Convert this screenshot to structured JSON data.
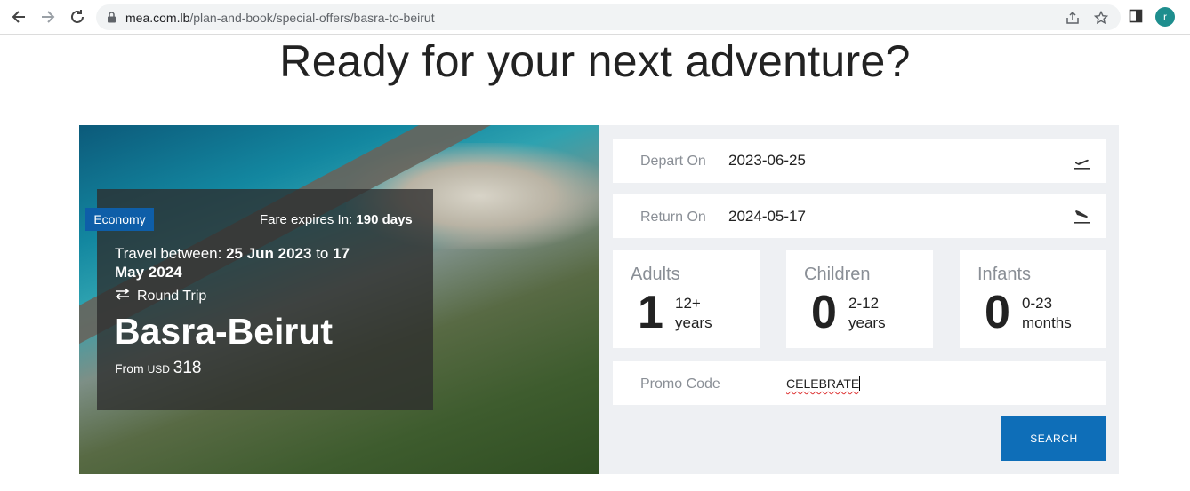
{
  "browser": {
    "url_domain": "mea.com.lb",
    "url_path": "/plan-and-book/special-offers/basra-to-beirut",
    "profile_initial": "r",
    "icons": [
      "back-icon",
      "forward-icon",
      "reload-icon",
      "lock-icon",
      "share-icon",
      "star-icon",
      "side-panel-icon"
    ]
  },
  "page": {
    "headline": "Ready for your next adventure?"
  },
  "offer": {
    "cabin": "Economy",
    "fare_expires_label": "Fare expires In:",
    "fare_expires_value": "190 days",
    "travel_label": "Travel between:",
    "travel_from": "25 Jun 2023",
    "travel_to_word": "to",
    "travel_to": "17 May 2024",
    "trip_type": "Round Trip",
    "route": "Basra-Beirut",
    "price_prefix": "From",
    "currency": "USD",
    "price": "318"
  },
  "form": {
    "depart_label": "Depart On",
    "depart_value": "2023-06-25",
    "return_label": "Return On",
    "return_value": "2024-05-17",
    "adults": {
      "label": "Adults",
      "count": "1",
      "desc1": "12+",
      "desc2": "years"
    },
    "children": {
      "label": "Children",
      "count": "0",
      "desc1": "2-12",
      "desc2": "years"
    },
    "infants": {
      "label": "Infants",
      "count": "0",
      "desc1": "0-23",
      "desc2": "months"
    },
    "promo_label": "Promo Code",
    "promo_value": "CELEBRATE",
    "search_label": "SEARCH"
  },
  "colors": {
    "accent": "#0e6eb8",
    "badge": "#0e5ea8",
    "panel_bg": "#eef0f3"
  }
}
